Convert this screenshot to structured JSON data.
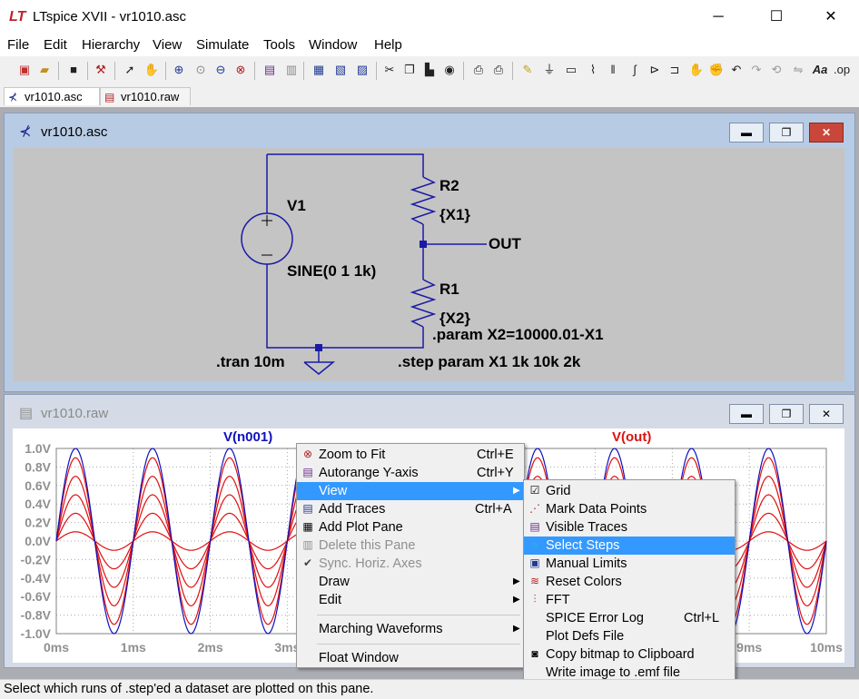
{
  "window": {
    "title": "LTspice XVII - vr1010.asc",
    "controls": [
      "─",
      "☐",
      "✕"
    ]
  },
  "menubar": [
    "File",
    "Edit",
    "Hierarchy",
    "View",
    "Simulate",
    "Tools",
    "Window",
    "Help"
  ],
  "tabs": [
    {
      "label": "vr1010.asc",
      "active": true
    },
    {
      "label": "vr1010.raw",
      "active": false
    }
  ],
  "schematic": {
    "title": "vr1010.asc",
    "v1_name": "V1",
    "v1_value": "SINE(0 1 1k)",
    "r2_name": "R2",
    "r2_value": "{X1}",
    "r1_name": "R1",
    "r1_value": "{X2}",
    "out_label": "OUT",
    "param": ".param X2=10000.01-X1",
    "tran": ".tran 10m",
    "step": ".step param X1 1k 10k 2k"
  },
  "waveform": {
    "title": "vr1010.raw",
    "trace_left": "V(n001)",
    "trace_right": "V(out)",
    "trace_left_color": "#1010c0",
    "trace_right_color": "#e01010"
  },
  "chart_data": {
    "type": "line",
    "xlabel": "",
    "ylabel": "",
    "x_ticks": [
      "0ms",
      "1ms",
      "2ms",
      "3ms",
      "9ms",
      "10ms"
    ],
    "y_ticks": [
      "1.0V",
      "0.8V",
      "0.6V",
      "0.4V",
      "0.2V",
      "0.0V",
      "-0.2V",
      "-0.4V",
      "-0.6V",
      "-0.8V",
      "-1.0V"
    ],
    "xlim": [
      0,
      10
    ],
    "ylim": [
      -1.0,
      1.0
    ],
    "frequency_khz": 1,
    "grid": true,
    "series": [
      {
        "name": "V(n001)",
        "amplitude": 1.0,
        "color": "#1010c0"
      },
      {
        "name": "V(out)",
        "amplitude": 0.9,
        "color": "#e01010"
      },
      {
        "name": "V(out)",
        "amplitude": 0.7,
        "color": "#e01010"
      },
      {
        "name": "V(out)",
        "amplitude": 0.5,
        "color": "#e01010"
      },
      {
        "name": "V(out)",
        "amplitude": 0.3,
        "color": "#e01010"
      },
      {
        "name": "V(out)",
        "amplitude": 0.1,
        "color": "#e01010"
      }
    ]
  },
  "context_menu": {
    "items": [
      {
        "label": "Zoom to Fit",
        "shortcut": "Ctrl+E",
        "icon": "zoom-fit-icon"
      },
      {
        "label": "Autorange Y-axis",
        "shortcut": "Ctrl+Y",
        "icon": "autorange-icon"
      },
      {
        "label": "View",
        "submenu": true,
        "highlighted": true
      },
      {
        "label": "Add Traces",
        "shortcut": "Ctrl+A",
        "icon": "add-traces-icon"
      },
      {
        "label": "Add Plot Pane",
        "icon": "plot-pane-icon"
      },
      {
        "label": "Delete this Pane",
        "disabled": true,
        "icon": "delete-pane-icon"
      },
      {
        "label": "Sync. Horiz. Axes",
        "disabled": true,
        "checked": true
      },
      {
        "label": "Draw",
        "submenu": true
      },
      {
        "label": "Edit",
        "submenu": true
      },
      {
        "label": "Marching Waveforms",
        "submenu": true
      },
      {
        "label": "Float Window"
      }
    ]
  },
  "view_submenu": {
    "items": [
      {
        "label": "Grid",
        "checked": true
      },
      {
        "label": "Mark Data Points",
        "icon": "mark-points-icon"
      },
      {
        "label": "Visible Traces",
        "icon": "visible-traces-icon"
      },
      {
        "label": "Select Steps",
        "highlighted": true,
        "icon": "select-steps-icon"
      },
      {
        "label": "Manual Limits",
        "icon": "manual-limits-icon"
      },
      {
        "label": "Reset Colors",
        "icon": "reset-colors-icon"
      },
      {
        "label": "FFT",
        "icon": "fft-icon"
      },
      {
        "label": "SPICE Error Log",
        "shortcut": "Ctrl+L"
      },
      {
        "label": "Plot Defs File"
      },
      {
        "label": "Copy bitmap to Clipboard",
        "icon": "camera-icon"
      },
      {
        "label": "Write image to .emf file"
      }
    ]
  },
  "status": "Select which runs of .step'ed a dataset are plotted on this pane."
}
